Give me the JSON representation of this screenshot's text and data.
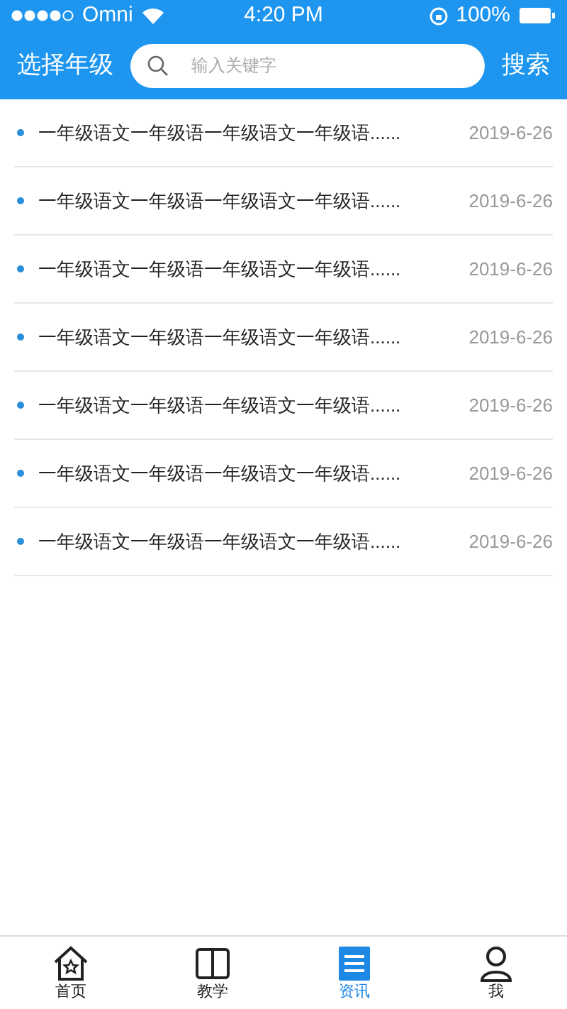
{
  "status_bar": {
    "carrier": "Omni",
    "time": "4:20 PM",
    "battery": "100%"
  },
  "header": {
    "grade_picker": "选择年级",
    "search": {
      "placeholder": "输入关键字"
    },
    "search_button": "搜索"
  },
  "news": [
    {
      "title": "一年级语文一年级语一年级语文一年级语......",
      "date": "2019-6-26"
    },
    {
      "title": "一年级语文一年级语一年级语文一年级语......",
      "date": "2019-6-26"
    },
    {
      "title": "一年级语文一年级语一年级语文一年级语......",
      "date": "2019-6-26"
    },
    {
      "title": "一年级语文一年级语一年级语文一年级语......",
      "date": "2019-6-26"
    },
    {
      "title": "一年级语文一年级语一年级语文一年级语......",
      "date": "2019-6-26"
    },
    {
      "title": "一年级语文一年级语一年级语文一年级语......",
      "date": "2019-6-26"
    },
    {
      "title": "一年级语文一年级语一年级语文一年级语......",
      "date": "2019-6-26"
    }
  ],
  "tab_bar": [
    {
      "kind": "home",
      "label": "首页",
      "selected": false
    },
    {
      "kind": "book",
      "label": "教学",
      "selected": false
    },
    {
      "kind": "news",
      "label": "资讯",
      "selected": true
    },
    {
      "kind": "user",
      "label": "我",
      "selected": false
    }
  ]
}
